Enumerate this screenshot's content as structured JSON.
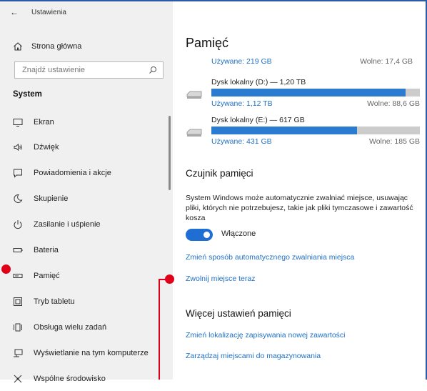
{
  "window": {
    "back_glyph": "←",
    "title": "Ustawienia"
  },
  "sidebar": {
    "home_label": "Strona główna",
    "search_placeholder": "Znajdź ustawienie",
    "section": "System",
    "items": [
      {
        "label": "Ekran",
        "icon": "monitor-icon"
      },
      {
        "label": "Dźwięk",
        "icon": "speaker-icon"
      },
      {
        "label": "Powiadomienia i akcje",
        "icon": "notification-icon"
      },
      {
        "label": "Skupienie",
        "icon": "moon-icon"
      },
      {
        "label": "Zasilanie i uśpienie",
        "icon": "power-icon"
      },
      {
        "label": "Bateria",
        "icon": "battery-icon"
      },
      {
        "label": "Pamięć",
        "icon": "storage-icon"
      },
      {
        "label": "Tryb tabletu",
        "icon": "tablet-icon"
      },
      {
        "label": "Obsługa wielu zadań",
        "icon": "multitasking-icon"
      },
      {
        "label": "Wyświetlanie na tym komputerze",
        "icon": "project-icon"
      },
      {
        "label": "Wspólne środowisko",
        "icon": "shared-icon"
      }
    ]
  },
  "main": {
    "title": "Pamięć",
    "top_used": "Używane: 219 GB",
    "top_free": "Wolne: 17,4 GB",
    "disks": [
      {
        "name": "Dysk lokalny (D:) — 1,20 TB",
        "used": "Używane: 1,12 TB",
        "free": "Wolne: 88,6 GB",
        "fill_fraction": 0.93
      },
      {
        "name": "Dysk lokalny (E:) — 617 GB",
        "used": "Używane: 431 GB",
        "free": "Wolne: 185 GB",
        "fill_fraction": 0.7
      }
    ],
    "sensor_heading": "Czujnik pamięci",
    "sensor_desc": "System Windows może automatycznie zwalniać miejsce, usuwając pliki, których nie potrzebujesz, takie jak pliki tymczasowe i zawartość kosza",
    "toggle_label": "Włączone",
    "toggle_on": true,
    "link_change": "Zmień sposób automatycznego zwalniania miejsca",
    "link_free_now": "Zwolnij miejsce teraz",
    "more_heading": "Więcej ustawień pamięci",
    "link_location": "Zmień lokalizację zapisywania nowej zawartości",
    "link_manage": "Zarządzaj miejscami do magazynowania"
  },
  "colors": {
    "accent": "#1e6fc4",
    "bar_fill": "#2b7bd1",
    "bar_bg": "#cccccc",
    "sidebar_bg": "#f0f0f0",
    "annotation": "#e0001a"
  }
}
